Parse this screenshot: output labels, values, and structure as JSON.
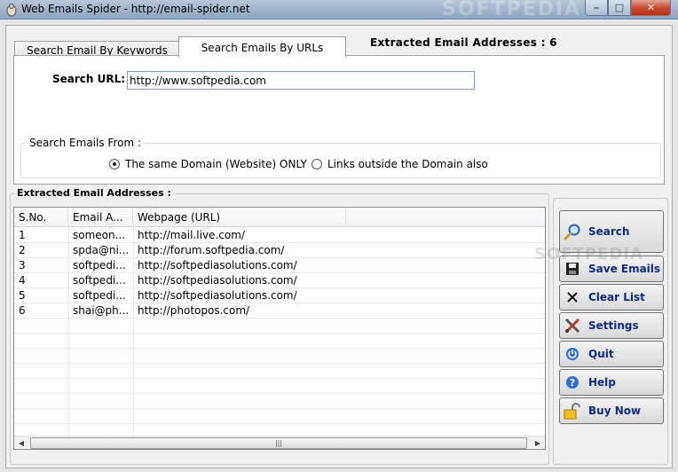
{
  "window": {
    "title": "Web Emails Spider - http://email-spider.net",
    "watermark": "SOFTPEDIA"
  },
  "tabs": [
    {
      "label": "Search Email By Keywords",
      "active": false
    },
    {
      "label": "Search Emails By URLs",
      "active": true
    }
  ],
  "extracted_count_text": "Extracted Email Addresses :  6",
  "search": {
    "label": "Search URL:",
    "value": "http://www.softpedia.com"
  },
  "search_from": {
    "legend": "Search Emails From :",
    "options": [
      {
        "label": "The same Domain (Website) ONLY",
        "selected": true
      },
      {
        "label": "Links outside the Domain also",
        "selected": false
      }
    ]
  },
  "results": {
    "label": "Extracted Email Addresses :",
    "columns": [
      "S.No.",
      "Email A...",
      "Webpage (URL)"
    ],
    "rows": [
      {
        "sno": "1",
        "email": "someon...",
        "url": "http://mail.live.com/"
      },
      {
        "sno": "2",
        "email": "spda@ni...",
        "url": "http://forum.softpedia.com/"
      },
      {
        "sno": "3",
        "email": "softpedi...",
        "url": "http://softpediasolutions.com/"
      },
      {
        "sno": "4",
        "email": "softpedi...",
        "url": "http://softpediasolutions.com/"
      },
      {
        "sno": "5",
        "email": "softpedi...",
        "url": "http://softpediasolutions.com/"
      },
      {
        "sno": "6",
        "email": "shai@ph...",
        "url": "http://photopos.com/"
      }
    ]
  },
  "buttons": {
    "search": "Search",
    "save": "Save Emails",
    "clear": "Clear List",
    "settings": "Settings",
    "quit": "Quit",
    "help": "Help",
    "buy": "Buy Now"
  },
  "softpedia_watermark": "SOFTPEDIA",
  "icons": {
    "search": "magnifier-icon",
    "save": "floppy-disk-icon",
    "clear": "x-close-icon",
    "settings": "tools-icon",
    "quit": "power-icon",
    "help": "help-icon",
    "buy": "padlock-icon"
  }
}
